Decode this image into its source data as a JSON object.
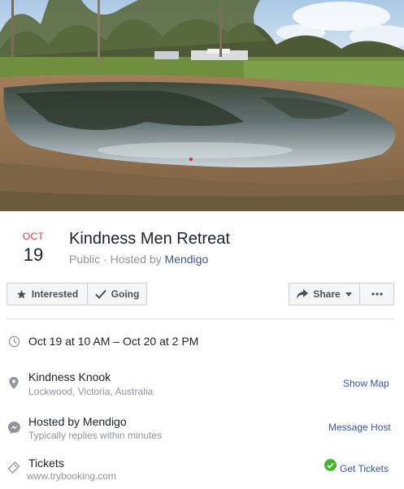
{
  "event": {
    "date_month": "OCT",
    "date_day": "19",
    "title": "Kindness Men Retreat",
    "privacy": "Public",
    "separator": " · ",
    "hosted_by_prefix": "Hosted by ",
    "host_name": "Mendigo"
  },
  "actions": {
    "interested_label": "Interested",
    "going_label": "Going",
    "share_label": "Share"
  },
  "details": {
    "datetime": "Oct 19 at 10 AM – Oct 20 at 2 PM",
    "location_name": "Kindness Knook",
    "location_address": "Lockwood, Victoria, Australia",
    "show_map_label": "Show Map",
    "hosted_by_label": "Hosted by Mendigo",
    "response_time": "Typically replies within minutes",
    "message_host_label": "Message Host",
    "tickets_label": "Tickets",
    "tickets_url": "www.trybooking.com",
    "get_tickets_label": "Get Tickets"
  },
  "icons": {
    "interested": "star-icon",
    "going": "checkmark-icon",
    "share": "share-arrow-icon",
    "more": "more-dots-icon",
    "datetime": "clock-icon",
    "location": "map-pin-icon",
    "host": "messenger-icon",
    "tickets": "ticket-icon",
    "get_tickets": "check-circle-icon"
  },
  "colors": {
    "date_red": "#e0393e",
    "link_blue": "#385898",
    "muted_text": "#90949c",
    "ticket_green": "#42b72a"
  }
}
